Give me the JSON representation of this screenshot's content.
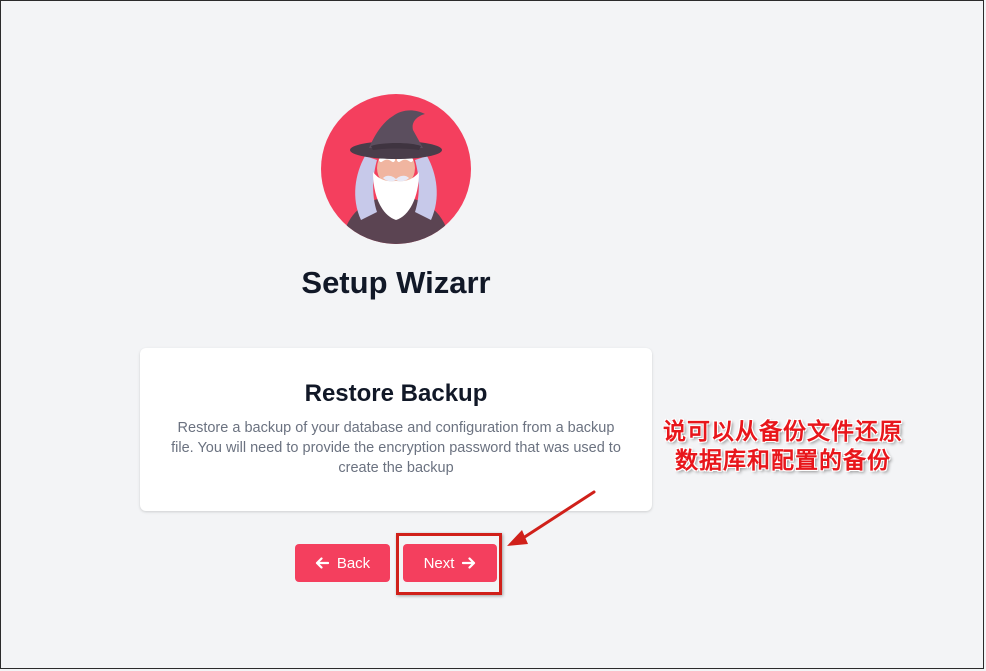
{
  "page": {
    "title": "Setup Wizarr"
  },
  "card": {
    "title": "Restore Backup",
    "description": "Restore a backup of your database and configuration from a backup file. You will need to provide the encryption password that was used to create the backup"
  },
  "buttons": {
    "back_label": "Back",
    "next_label": "Next"
  },
  "annotation": {
    "line1": "说可以从备份文件还原",
    "line2": "数据库和配置的备份"
  },
  "icons": {
    "logo": "wizard-logo-icon",
    "back": "arrow-left-icon",
    "next": "arrow-right-icon"
  },
  "colors": {
    "accent": "#f43f5e",
    "background": "#f3f4f6",
    "annotation": "#e8161b"
  }
}
